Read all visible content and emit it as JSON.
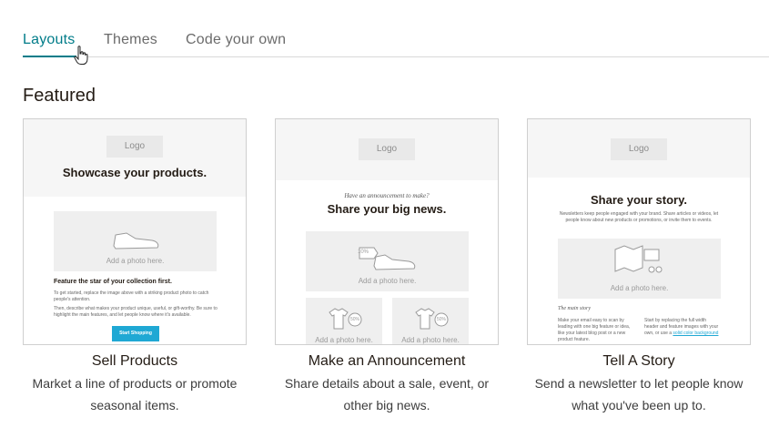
{
  "tabs": [
    {
      "label": "Layouts",
      "active": true
    },
    {
      "label": "Themes",
      "active": false
    },
    {
      "label": "Code your own",
      "active": false
    }
  ],
  "section_title": "Featured",
  "cards": [
    {
      "preview": {
        "logo": "Logo",
        "heading": "Showcase your products.",
        "photo_label": "Add a photo here.",
        "subheading": "Feature the star of your collection first.",
        "body1": "To get started, replace the image above with a striking product photo to catch people's attention.",
        "body2": "Then, describe what makes your product unique, useful, or gift-worthy. Be sure to highlight the main features, and let people know where it's available.",
        "button": "Start Shopping"
      },
      "title": "Sell Products",
      "description_line1": "Market a line of products or promote",
      "description_line2": "seasonal items."
    },
    {
      "preview": {
        "logo": "Logo",
        "kicker": "Have an announcement to make?",
        "heading": "Share your big news.",
        "photo_label": "Add a photo here.",
        "photo_label_2": "Add a photo here.",
        "photo_label_3": "Add a photo here.",
        "tag1": "10%",
        "tag2": "50%",
        "tag3": "50%"
      },
      "title": "Make an Announcement",
      "description_line1": "Share details about a sale, event, or",
      "description_line2": "other big news."
    },
    {
      "preview": {
        "logo": "Logo",
        "heading": "Share your story.",
        "intro": "Newsletters keep people engaged with your brand. Share articles or videos, let people know about new products or promotions, or invite them to events.",
        "photo_label": "Add a photo here.",
        "kicker": "The main story",
        "col1": "Make your email easy to scan by leading with one big feature or idea, like your latest blog post or a new product feature.",
        "col2_pre": "Start by replacing the full width header and feature images with your own, or use a",
        "col2_link": "solid color background"
      },
      "title": "Tell A Story",
      "description_line1": "Send a newsletter to let people know",
      "description_line2": "what you've been up to."
    }
  ],
  "colors": {
    "accent": "#007c89",
    "button": "#1fa8d4",
    "border": "#cfcfcf"
  }
}
